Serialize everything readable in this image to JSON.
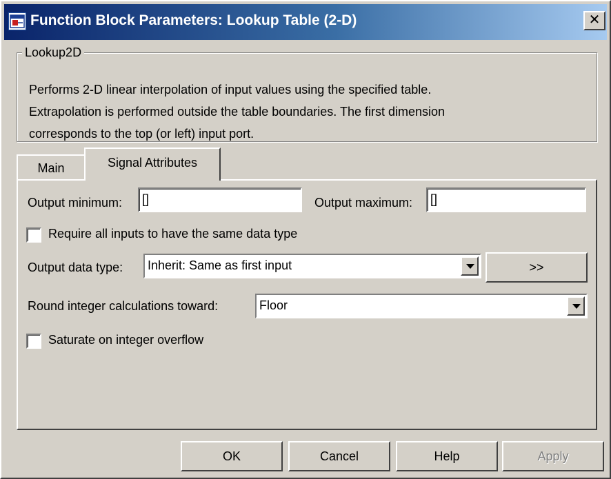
{
  "window": {
    "title": "Function Block Parameters: Lookup Table (2-D)",
    "close_symbol": "✕"
  },
  "group": {
    "legend": "Lookup2D",
    "description_lines": [
      "Performs 2-D linear interpolation of input values using the specified table.",
      "Extrapolation is performed outside the table boundaries.  The first dimension",
      "corresponds to the top (or left) input port."
    ]
  },
  "tabs": [
    {
      "label": "Main",
      "active": false
    },
    {
      "label": "Signal Attributes",
      "active": true
    }
  ],
  "signal_attributes": {
    "output_minimum_label": "Output minimum:",
    "output_minimum_value": "[]",
    "output_maximum_label": "Output maximum:",
    "output_maximum_value": "[]",
    "require_same_type_label": "Require all inputs to have the same data type",
    "require_same_type_checked": false,
    "output_data_type_label": "Output data type:",
    "output_data_type_value": "Inherit: Same as first input",
    "data_type_assistant_label": ">>",
    "round_label": "Round integer calculations toward:",
    "round_value": "Floor",
    "saturate_label": "Saturate on integer overflow",
    "saturate_checked": false
  },
  "buttons": {
    "ok": "OK",
    "cancel": "Cancel",
    "help": "Help",
    "apply": "Apply"
  },
  "icons": {
    "app": "simulink-block-icon",
    "close": "close-icon",
    "dropdown": "chevron-down-icon"
  }
}
